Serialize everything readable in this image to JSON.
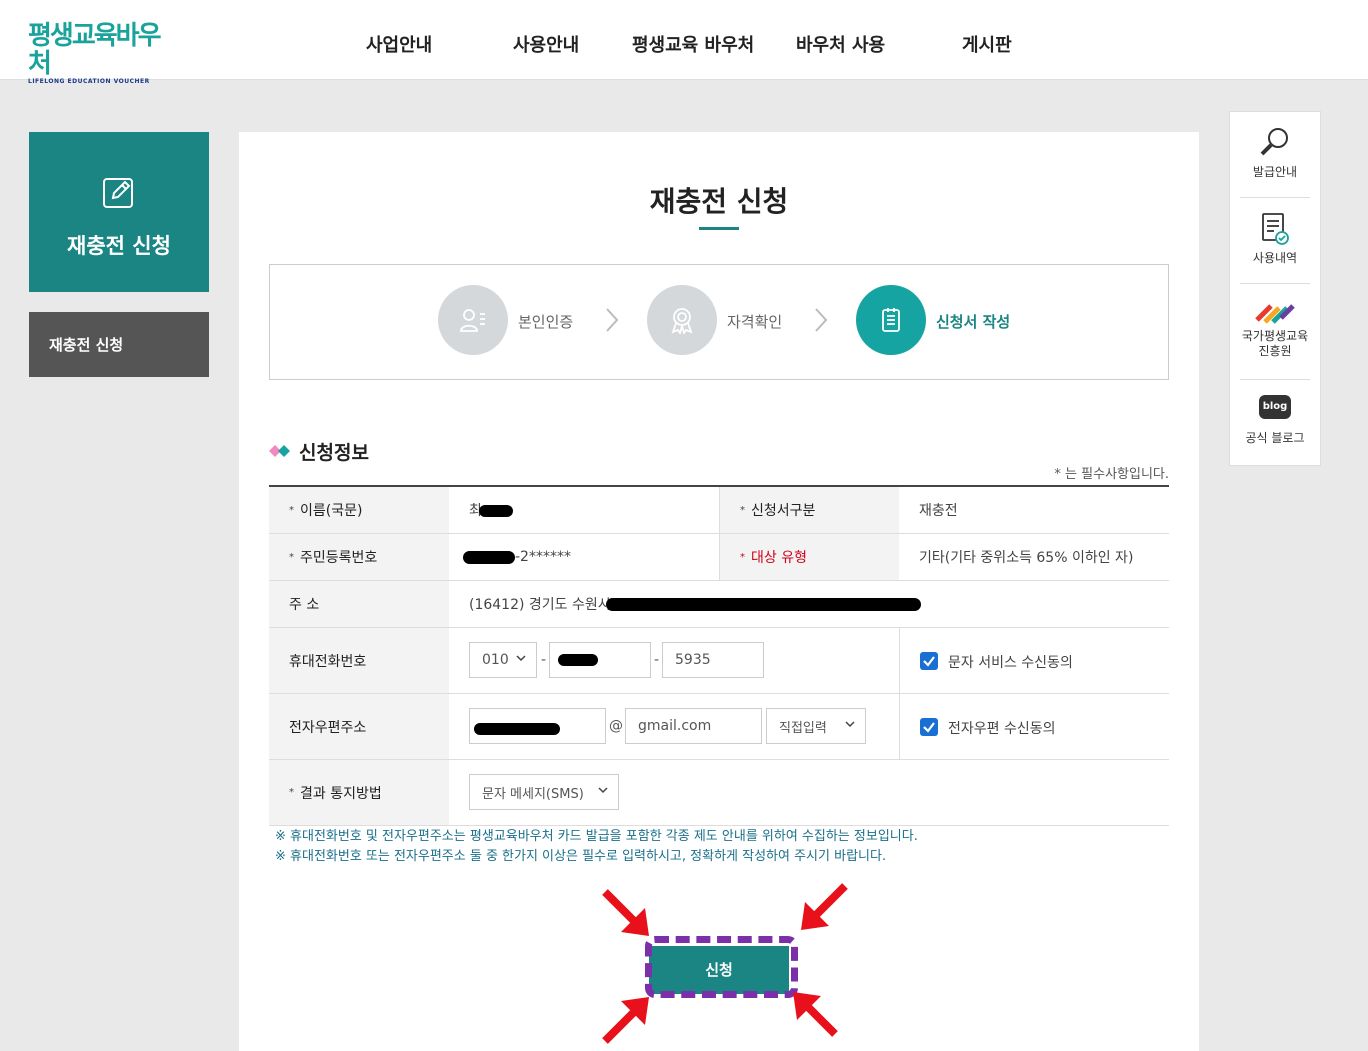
{
  "header": {
    "logo_text": "평생교육바우처",
    "logo_sub": "LIFELONG EDUCATION VOUCHER",
    "nav": [
      "사업안내",
      "사용안내",
      "평생교육 바우처",
      "바우처 사용",
      "게시판"
    ]
  },
  "sidebar": {
    "hero_title": "재충전 신청",
    "menu_item": "재충전 신청"
  },
  "page": {
    "title": "재충전 신청",
    "steps": [
      "본인인증",
      "자격확인",
      "신청서 작성"
    ],
    "active_step": 3
  },
  "section": {
    "title": "신청정보",
    "required_note": "* 는 필수사항입니다."
  },
  "form": {
    "name_label": "이름(국문)",
    "name_value": "최",
    "app_type_label": "신청서구분",
    "app_type_value": "재충전",
    "rrn_label": "주민등록번호",
    "rrn_value": "-2******",
    "target_label": "대상 유형",
    "target_value": "기타(기타 중위소득 65% 이하인 자)",
    "address_label": "주 소",
    "address_value": "(16412) 경기도 수원시",
    "phone_label": "휴대전화번호",
    "phone_prefix": "010",
    "phone_last": "5935",
    "sms_consent": "문자 서비스 수신동의",
    "email_label": "전자우편주소",
    "email_at": "@",
    "email_domain": "gmail.com",
    "email_select": "직접입력",
    "email_consent": "전자우편 수신동의",
    "notify_label": "결과 통지방법",
    "notify_value": "문자 메세지(SMS)"
  },
  "notes": [
    "※ 휴대전화번호 및 전자우편주소는 평생교육바우처 카드 발급을 포함한 각종 제도 안내를 위하여 수집하는 정보입니다.",
    "※ 휴대전화번호 또는 전자우편주소 둘 중 한가지 이상은 필수로 입력하시고, 정확하게 작성하여 주시기 바랍니다."
  ],
  "submit_label": "신청",
  "quick_menu": {
    "issue": "발급안내",
    "history": "사용내역",
    "nile_line1": "국가평생교육",
    "nile_line2": "진흥원",
    "blog_badge": "blog",
    "blog": "공식 블로그"
  },
  "colors": {
    "teal": "#1a8583",
    "step_active": "#16a4a3",
    "highlight": "#7b2fa8",
    "arrow": "#e8101a"
  }
}
